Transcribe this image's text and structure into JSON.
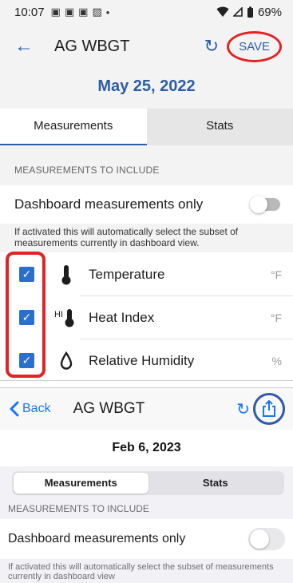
{
  "android": {
    "status_bar": {
      "time": "10:07",
      "battery": "69%"
    },
    "app_bar": {
      "back_icon": "arrow-left-icon",
      "title": "AG WBGT",
      "refresh_icon": "refresh-icon",
      "save_label": "SAVE"
    },
    "date": "May 25, 2022",
    "tabs": [
      {
        "label": "Measurements",
        "active": true
      },
      {
        "label": "Stats",
        "active": false
      }
    ],
    "section_header": "MEASUREMENTS TO INCLUDE",
    "dashboard_toggle": {
      "label": "Dashboard measurements only",
      "on": false
    },
    "help_text": "If activated this will automatically select the subset of measurements currently in dashboard view.",
    "measurements": [
      {
        "icon": "thermometer-icon",
        "label": "Temperature",
        "unit": "°F",
        "checked": true
      },
      {
        "icon": "heat-index-icon",
        "icon_text": "HI",
        "label": "Heat Index",
        "unit": "°F",
        "checked": true
      },
      {
        "icon": "water-drop-icon",
        "label": "Relative Humidity",
        "unit": "%",
        "checked": true
      }
    ],
    "colors": {
      "accent": "#2a5fa8",
      "highlight": "#e02424",
      "checkbox": "#2a6fce"
    }
  },
  "ios": {
    "nav": {
      "back_label": "Back",
      "title": "AG WBGT",
      "refresh_icon": "refresh-icon",
      "share_icon": "share-icon"
    },
    "date": "Feb 6, 2023",
    "tabs": [
      {
        "label": "Measurements",
        "active": true
      },
      {
        "label": "Stats",
        "active": false
      }
    ],
    "section_header": "MEASUREMENTS TO INCLUDE",
    "dashboard_toggle": {
      "label": "Dashboard measurements only",
      "on": false
    },
    "help_text": "If activated this will automatically select the subset of measurements currently in dashboard view",
    "colors": {
      "accent": "#1877f2",
      "highlight": "#2f5aa6"
    }
  }
}
